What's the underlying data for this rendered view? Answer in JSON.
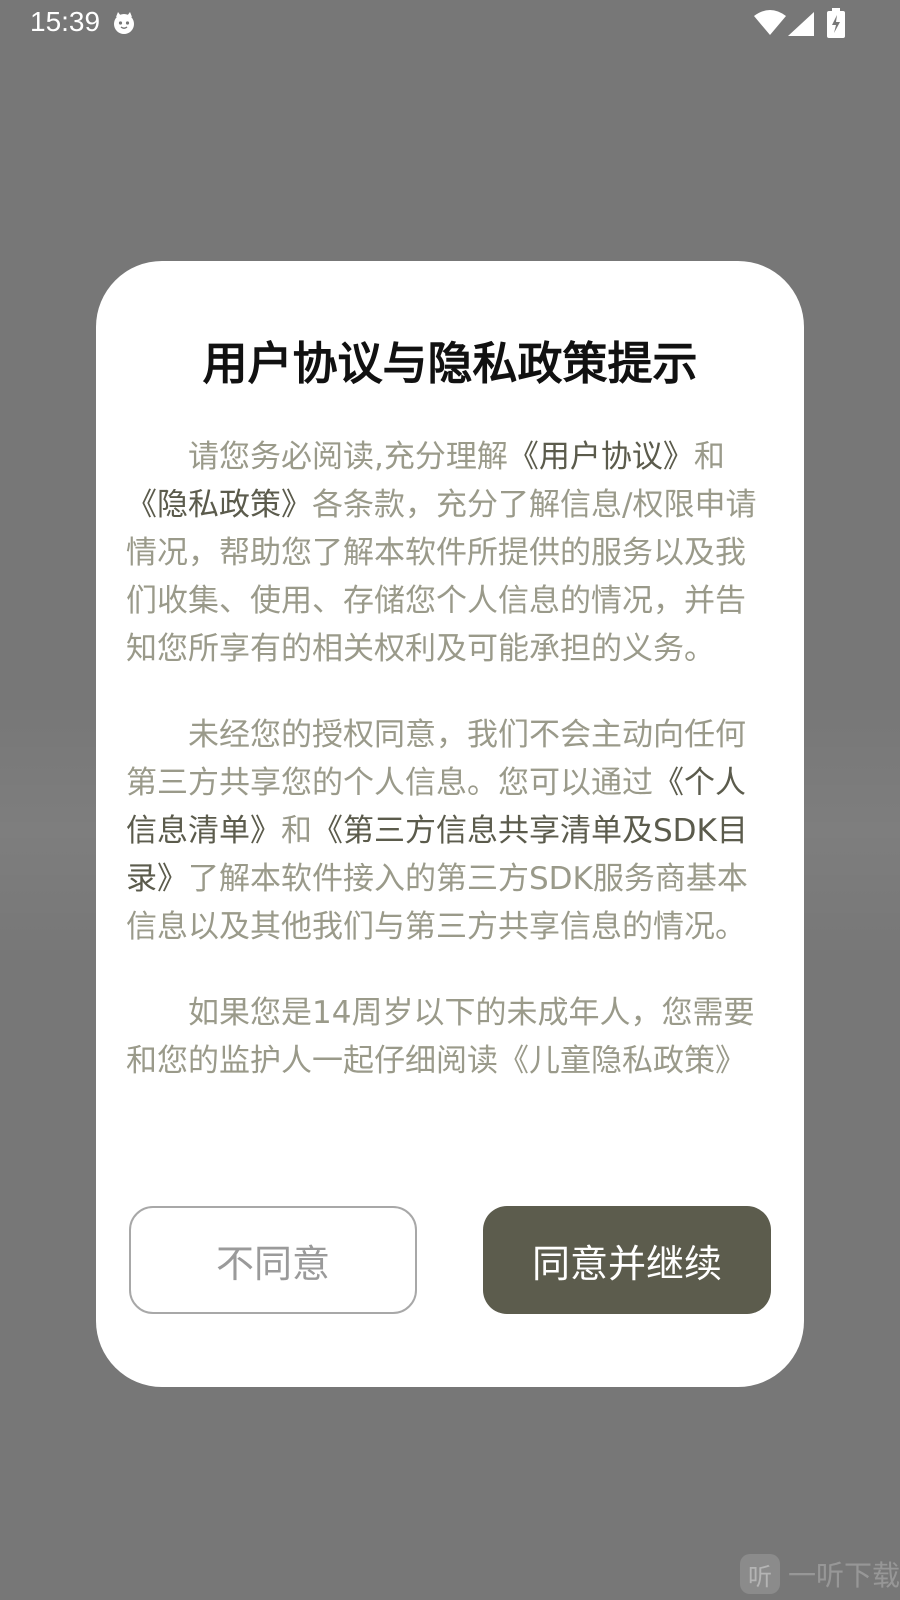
{
  "status_bar": {
    "time": "15:39",
    "icons": [
      "cat-notification-icon",
      "wifi-icon",
      "signal-icon",
      "battery-charging-icon"
    ]
  },
  "dialog": {
    "title": "用户协议与隐私政策提示",
    "paragraphs": [
      {
        "parts": [
          {
            "text": "请您务必阅读,充分理解",
            "link": false
          },
          {
            "text": "《用户协议》",
            "link": true
          },
          {
            "text": "和",
            "link": false
          },
          {
            "text": "《隐私政策》",
            "link": true
          },
          {
            "text": "各条款，充分了解信息/权限申请情况，帮助您了解本软件所提供的服务以及我们收集、使用、存储您个人信息的情况，并告知您所享有的相关权利及可能承担的义务。",
            "link": false
          }
        ]
      },
      {
        "parts": [
          {
            "text": "未经您的授权同意，我们不会主动向任何第三方共享您的个人信息。您可以通过",
            "link": false
          },
          {
            "text": "《个人信息清单》",
            "link": true
          },
          {
            "text": "和",
            "link": false
          },
          {
            "text": "《第三方信息共享清单及SDK目录》",
            "link": true
          },
          {
            "text": "了解本软件接入的第三方SDK服务商基本信息以及其他我们与第三方共享信息的情况。",
            "link": false
          }
        ]
      },
      {
        "parts": [
          {
            "text": "如果您是14周岁以下的未成年人，您需要和您的监护人一起仔细阅读《儿童隐私政策》",
            "link": false
          }
        ]
      }
    ],
    "disagree_label": "不同意",
    "agree_label": "同意并继续"
  },
  "watermark": {
    "icon_char": "听",
    "text": "一听下载"
  },
  "colors": {
    "overlay": "#777777",
    "body_text": "#9a9a8a",
    "link_text": "#5b5b4c",
    "agree_button": "#5c5c4d"
  }
}
